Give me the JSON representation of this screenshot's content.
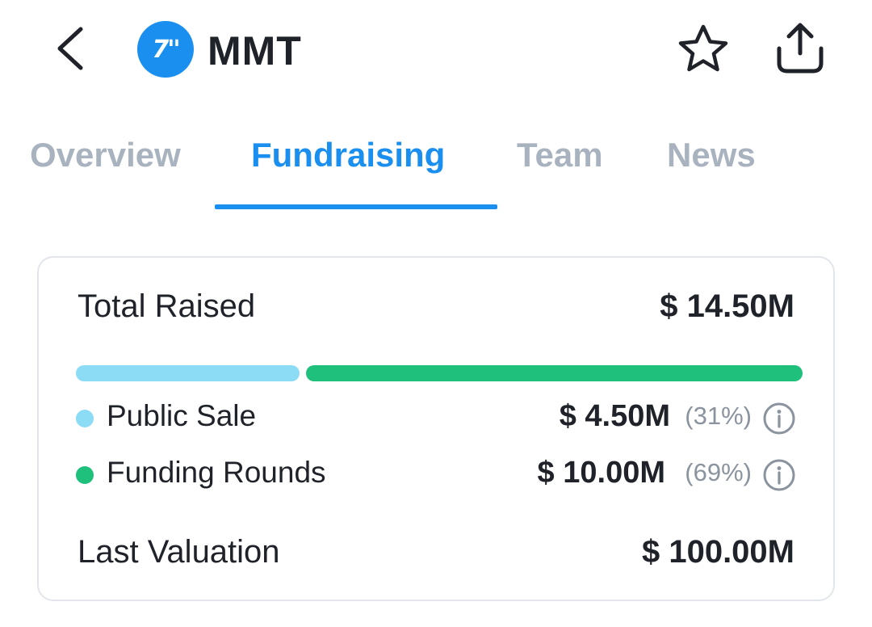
{
  "header": {
    "logo_text": "7''",
    "title": "MMT"
  },
  "tabs": [
    {
      "label": "Overview",
      "active": false
    },
    {
      "label": "Fundraising",
      "active": true
    },
    {
      "label": "Team",
      "active": false
    },
    {
      "label": "News",
      "active": false
    }
  ],
  "card": {
    "total_raised": {
      "label": "Total Raised",
      "value": "$ 14.50M"
    },
    "breakdown": [
      {
        "label": "Public Sale",
        "value": "$ 4.50M",
        "pct_text": "(31%)",
        "share": 0.31,
        "color": "#8ddcf5"
      },
      {
        "label": "Funding Rounds",
        "value": "$ 10.00M",
        "pct_text": "(69%)",
        "share": 0.69,
        "color": "#1ec07c"
      }
    ],
    "last_valuation": {
      "label": "Last Valuation",
      "value": "$ 100.00M"
    }
  },
  "colors": {
    "accent": "#1a8ff0",
    "tab_inactive": "#a9b3bf",
    "public_sale": "#8ddcf5",
    "funding_rounds": "#1ec07c"
  },
  "icons": {
    "back": "chevron-left-icon",
    "star": "star-outline-icon",
    "share": "share-icon",
    "info": "info-icon"
  }
}
